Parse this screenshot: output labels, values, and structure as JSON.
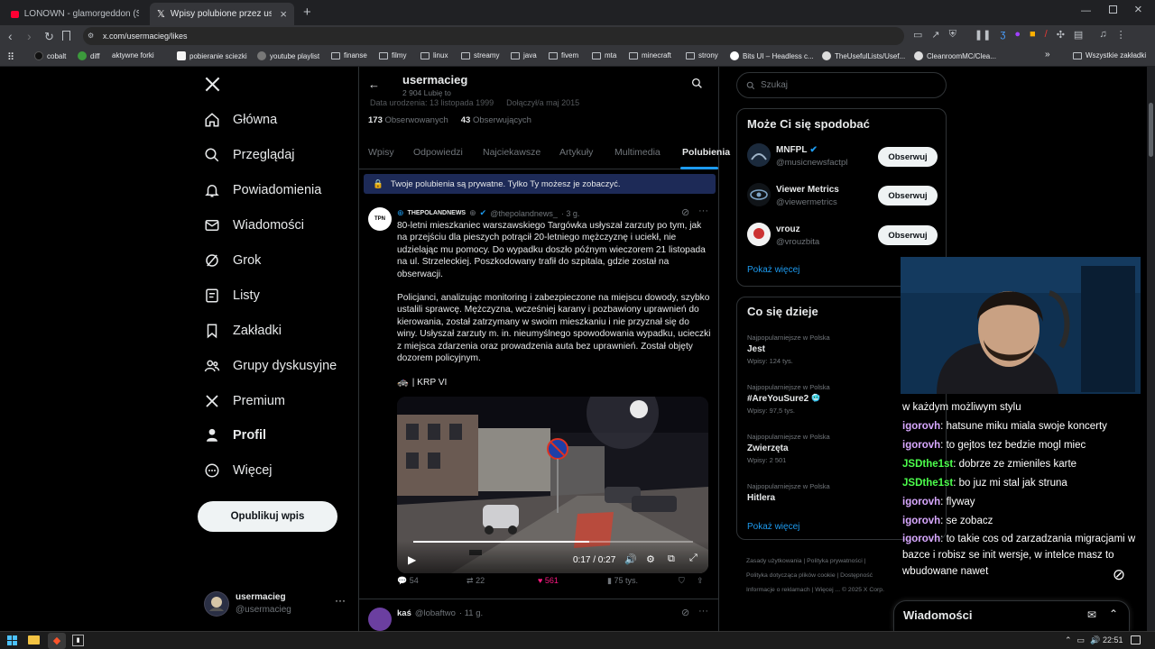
{
  "browser": {
    "tabs": [
      {
        "title": "LONOWN - glamorgeddon (Slowed)",
        "active": false
      },
      {
        "title": "Wpisy polubione przez usermaci...",
        "active": true
      }
    ],
    "new_tab": "+",
    "url": "x.com/usermacieg/likes",
    "bookmarks": [
      "cobalt",
      "diff",
      "aktywne forki",
      "pobieranie sciezki",
      "youtube playlist",
      "finanse",
      "filmy",
      "linux",
      "streamy",
      "java",
      "fivem",
      "mta",
      "minecraft",
      "strony",
      "Bits UI – Headless c...",
      "TheUsefulLists/Usef...",
      "CleanroomMC/Clea..."
    ],
    "bookmarks_more": "»",
    "all_bookmarks": "Wszystkie zakładki"
  },
  "nav": {
    "items": [
      {
        "label": "Główna",
        "icon": "home-icon"
      },
      {
        "label": "Przeglądaj",
        "icon": "search-icon"
      },
      {
        "label": "Powiadomienia",
        "icon": "bell-icon"
      },
      {
        "label": "Wiadomości",
        "icon": "mail-icon"
      },
      {
        "label": "Grok",
        "icon": "grok-icon"
      },
      {
        "label": "Listy",
        "icon": "list-icon"
      },
      {
        "label": "Zakładki",
        "icon": "bookmark-icon"
      },
      {
        "label": "Grupy dyskusyjne",
        "icon": "people-icon"
      },
      {
        "label": "Premium",
        "icon": "x-logo-icon"
      },
      {
        "label": "Profil",
        "icon": "person-icon"
      },
      {
        "label": "Więcej",
        "icon": "more-circle-icon"
      }
    ],
    "post_button": "Opublikuj wpis",
    "account": {
      "name": "usermacieg",
      "handle": "@usermacieg"
    }
  },
  "profile": {
    "name": "usermacieg",
    "likes_count": "2 904 Lubię to",
    "birth": "Data urodzenia: 13 listopada 1999",
    "joined": "Dołączył/a maj 2015",
    "following_num": "173",
    "following_label": "Obserwowanych",
    "followers_num": "43",
    "followers_label": "Obserwujących",
    "tabs": [
      "Wpisy",
      "Odpowiedzi",
      "Najciekawsze",
      "Artykuły",
      "Multimedia",
      "Polubienia"
    ],
    "private_notice": "Twoje polubienia są prywatne. Tylko Ty możesz je zobaczyć."
  },
  "tweet": {
    "avatar_text": "TPN",
    "author": "THEPOLANDNEWS",
    "handle": "@thepolandnews_",
    "time": "· 3 g.",
    "para1": "80-letni mieszkaniec warszawskiego Targówka usłyszał zarzuty po tym, jak na przejściu dla pieszych potrącił 20-letniego mężczyznę i uciekł, nie udzielając mu pomocy. Do wypadku doszło późnym wieczorem 21 listopada na ul. Strzeleckiej. Poszkodowany trafił do szpitala, gdzie został na obserwacji.",
    "para2": "Policjanci, analizując monitoring i zabezpieczone na miejscu dowody, szybko ustalili sprawcę. Mężczyzna, wcześniej karany i pozbawiony uprawnień do kierowania, został zatrzymany w swoim mieszkaniu i nie przyznał się do winy. Usłyszał zarzuty m. in. nieumyślnego spowodowania wypadku, ucieczki z miejsca zdarzenia oraz prowadzenia auta bez uprawnień. Został objęty dozorem policyjnym.",
    "source": "| KRP VI",
    "video_time": "0:17 / 0:27",
    "video_progress": 0.63,
    "replies": "54",
    "reposts": "22",
    "likes": "561",
    "views": "75 tys."
  },
  "tweet2": {
    "author": "kaś",
    "handle": "@lobaftwo",
    "time": "· 11 g."
  },
  "right": {
    "search_placeholder": "Szukaj",
    "suggest_title": "Może Ci się spodobać",
    "suggestions": [
      {
        "name": "MNFPL",
        "handle": "@musicnewsfactpl",
        "verified": true
      },
      {
        "name": "Viewer Metrics",
        "handle": "@viewermetrics",
        "verified": false
      },
      {
        "name": "vrouz",
        "handle": "@vrouzbita",
        "verified": false
      }
    ],
    "follow_label": "Obserwuj",
    "show_more": "Pokaż więcej",
    "trends_title": "Co się dzieje",
    "trends": [
      {
        "meta": "Najpopularniejsze w Polska",
        "name": "Jest",
        "count": "Wpisy: 124 tys."
      },
      {
        "meta": "Najpopularniejsze w Polska",
        "name": "#AreYouSure2",
        "count": "Wpisy: 97,5 tys."
      },
      {
        "meta": "Najpopularniejsze w Polska",
        "name": "Zwierzęta",
        "count": "Wpisy: 2 501"
      },
      {
        "meta": "Najpopularniejsze w Polska",
        "name": "Hitlera",
        "count": ""
      }
    ],
    "footer": [
      "Zasady użytkowania",
      "|",
      "Polityka prywatności",
      "|",
      "Polityka dotycząca plików cookie",
      "|",
      "Dostępność",
      "Informacje o reklamach",
      "|",
      "Więcej ...",
      "© 2025 X Corp."
    ],
    "messages": "Wiadomości"
  },
  "chat": [
    {
      "user": "",
      "text": "w każdym możliwym stylu",
      "color": "#ffffff"
    },
    {
      "user": "igorovh",
      "text": "hatsune miku miala swoje koncerty",
      "color": "#d8a8ff"
    },
    {
      "user": "igorovh",
      "text": "to gejtos tez bedzie mogl miec",
      "color": "#d8a8ff"
    },
    {
      "user": "JSDthe1st",
      "text": "dobrze ze zmieniles karte",
      "color": "#4cff4c"
    },
    {
      "user": "JSDthe1st",
      "text": "bo juz mi stal jak struna",
      "color": "#4cff4c"
    },
    {
      "user": "igorovh",
      "text": "flyway",
      "color": "#d8a8ff"
    },
    {
      "user": "igorovh",
      "text": "se zobacz",
      "color": "#d8a8ff"
    },
    {
      "user": "igorovh",
      "text": "to takie cos od zarzadzania migracjami w bazce i robisz se init wersje, w intelce masz to wbudowane nawet",
      "color": "#d8a8ff"
    }
  ],
  "taskbar": {
    "time": "22:51"
  },
  "colors": {
    "accent": "#1d9bf0",
    "like": "#f91880",
    "bg": "#000000",
    "border": "#2f3336"
  }
}
